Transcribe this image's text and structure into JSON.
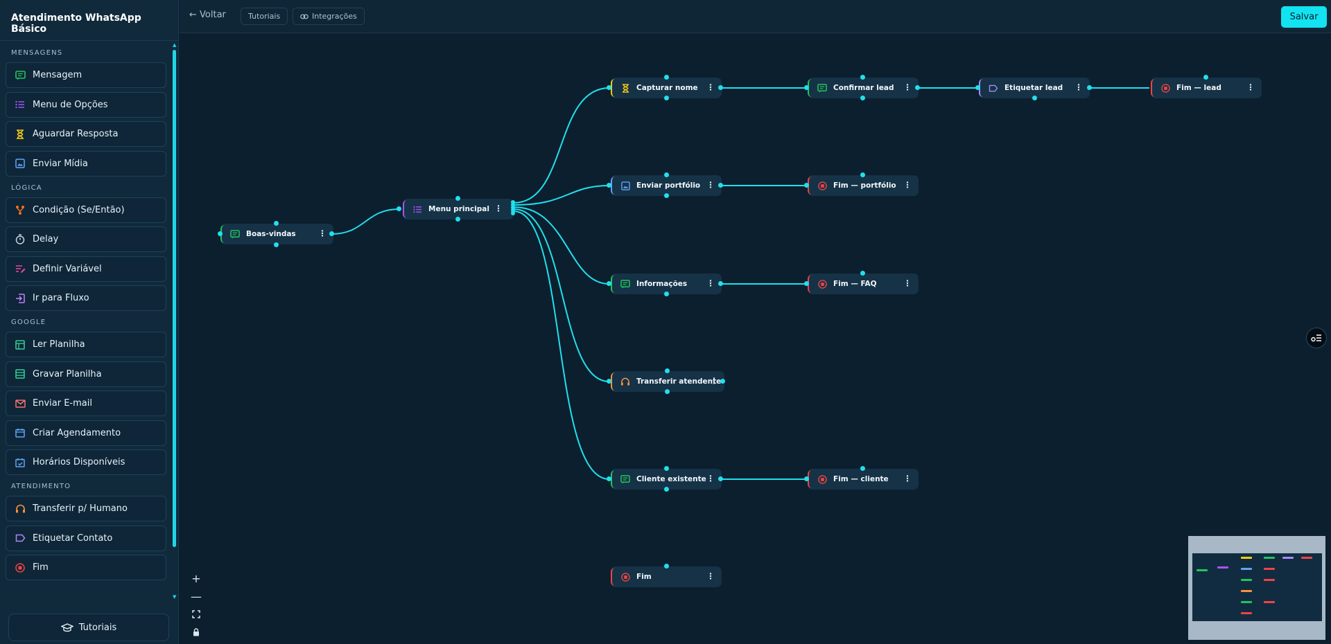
{
  "app": {
    "title": "Atendimento WhatsApp Básico"
  },
  "topbar": {
    "back_label": "← Voltar",
    "tutorials_label": "Tutoriais",
    "integrations_label": "Integrações",
    "save_label": "Salvar"
  },
  "sidebar": {
    "sections": [
      {
        "label": "MENSAGENS",
        "items": [
          {
            "label": "Mensagem",
            "icon": "message-icon",
            "color": "#22c55e"
          },
          {
            "label": "Menu de Opções",
            "icon": "list-icon",
            "color": "#a855f7"
          },
          {
            "label": "Aguardar Resposta",
            "icon": "hourglass-icon",
            "color": "#facc15"
          },
          {
            "label": "Enviar Mídia",
            "icon": "image-icon",
            "color": "#60a5fa"
          }
        ]
      },
      {
        "label": "LÓGICA",
        "items": [
          {
            "label": "Condição (Se/Então)",
            "icon": "branch-icon",
            "color": "#f97316"
          },
          {
            "label": "Delay",
            "icon": "timer-icon",
            "color": "#cbd5e1"
          },
          {
            "label": "Definir Variável",
            "icon": "edit-variable-icon",
            "color": "#ec4899"
          },
          {
            "label": "Ir para Fluxo",
            "icon": "goto-flow-icon",
            "color": "#c084fc"
          }
        ]
      },
      {
        "label": "GOOGLE",
        "items": [
          {
            "label": "Ler Planilha",
            "icon": "sheet-read-icon",
            "color": "#34d399"
          },
          {
            "label": "Gravar Planilha",
            "icon": "sheet-write-icon",
            "color": "#34d399"
          },
          {
            "label": "Enviar E-mail",
            "icon": "mail-icon",
            "color": "#f87171"
          },
          {
            "label": "Criar Agendamento",
            "icon": "calendar-icon",
            "color": "#60a5fa"
          },
          {
            "label": "Horários Disponíveis",
            "icon": "calendar-check-icon",
            "color": "#60a5fa"
          }
        ]
      },
      {
        "label": "ATENDIMENTO",
        "items": [
          {
            "label": "Transferir p/ Humano",
            "icon": "headset-icon",
            "color": "#fb923c"
          },
          {
            "label": "Etiquetar Contato",
            "icon": "tag-icon",
            "color": "#a78bfa"
          },
          {
            "label": "Fim",
            "icon": "stop-icon",
            "color": "#ef4444"
          }
        ]
      }
    ],
    "tutorials_label": "Tutoriais"
  },
  "canvas": {
    "nodes": [
      {
        "id": "boas-vindas",
        "label": "Boas-vindas",
        "icon": "message-icon",
        "color": "#22c55e"
      },
      {
        "id": "menu-principal",
        "label": "Menu principal",
        "icon": "list-icon",
        "color": "#a855f7"
      },
      {
        "id": "capturar-nome",
        "label": "Capturar nome",
        "icon": "hourglass-icon",
        "color": "#facc15"
      },
      {
        "id": "confirmar-lead",
        "label": "Confirmar lead",
        "icon": "message-icon",
        "color": "#22c55e"
      },
      {
        "id": "etiquetar-lead",
        "label": "Etiquetar lead",
        "icon": "tag-icon",
        "color": "#a78bfa"
      },
      {
        "id": "fim-lead",
        "label": "Fim — lead",
        "icon": "stop-icon",
        "color": "#ef4444"
      },
      {
        "id": "enviar-portfolio",
        "label": "Enviar portfólio",
        "icon": "image-icon",
        "color": "#60a5fa"
      },
      {
        "id": "fim-portfolio",
        "label": "Fim — portfólio",
        "icon": "stop-icon",
        "color": "#ef4444"
      },
      {
        "id": "informacoes",
        "label": "Informações",
        "icon": "message-icon",
        "color": "#22c55e"
      },
      {
        "id": "fim-faq",
        "label": "Fim — FAQ",
        "icon": "stop-icon",
        "color": "#ef4444"
      },
      {
        "id": "transferir-atendente",
        "label": "Transferir atendente",
        "icon": "headset-icon",
        "color": "#fb923c"
      },
      {
        "id": "cliente-existente",
        "label": "Cliente existente",
        "icon": "message-icon",
        "color": "#22c55e"
      },
      {
        "id": "fim-cliente",
        "label": "Fim — cliente",
        "icon": "stop-icon",
        "color": "#ef4444"
      },
      {
        "id": "fim",
        "label": "Fim",
        "icon": "stop-icon",
        "color": "#ef4444"
      }
    ],
    "edge_color": "#21e0ee",
    "minimap_bg": "#a8b8c6"
  }
}
